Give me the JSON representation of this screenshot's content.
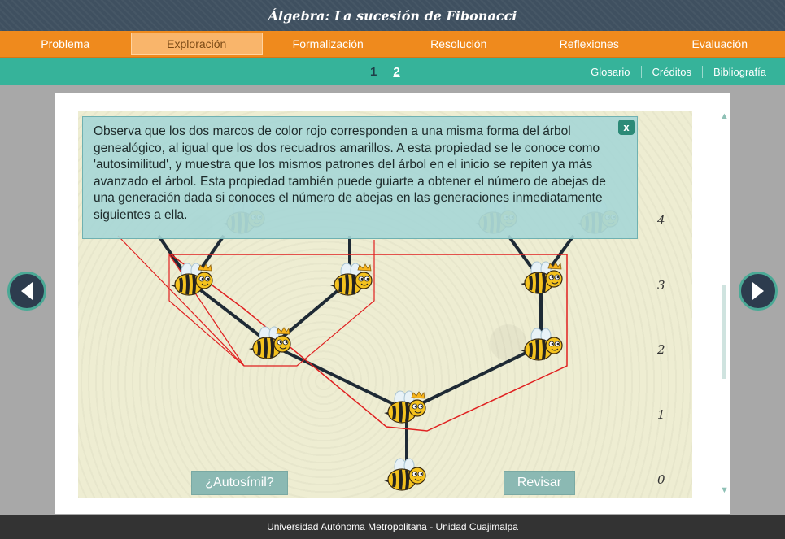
{
  "app": {
    "title": "Álgebra: La sucesión de Fibonacci"
  },
  "main_nav": {
    "tabs": [
      {
        "label": "Problema"
      },
      {
        "label": "Exploración",
        "active": true
      },
      {
        "label": "Formalización"
      },
      {
        "label": "Resolución"
      },
      {
        "label": "Reflexiones"
      },
      {
        "label": "Evaluación"
      }
    ]
  },
  "sub_nav": {
    "pages": [
      "1",
      "2"
    ],
    "current_page": "2",
    "links": [
      "Glosario",
      "Créditos",
      "Bibliografía"
    ]
  },
  "overlay": {
    "text": "Observa que los dos marcos de color rojo corresponden a una misma forma del árbol genealógico, al igual que los dos recuadros amarillos. A esta propiedad se le conoce como 'autosimilitud', y muestra que los mismos patrones del árbol en el inicio se repiten ya más avanzado el árbol. Esta propiedad también puede guiarte a obtener el número de abejas de una generación dada si conoces el número de abejas en las generaciones inmediatamente siguientes a ella.",
    "close_label": "x"
  },
  "generations": [
    "4",
    "3",
    "2",
    "1",
    "0"
  ],
  "buttons": {
    "autosimil": "¿Autosímil?",
    "revisar": "Revisar"
  },
  "footer": {
    "text": "Universidad Autónoma Metropolitana - Unidad Cuajimalpa"
  },
  "colors": {
    "orange": "#ef8a1d",
    "teal": "#36b39a",
    "dark": "#3f5060",
    "frame_red": "#e02020"
  },
  "icons": {
    "prev": "chevron-left-icon",
    "next": "chevron-right-icon",
    "bee": "bee-icon",
    "queen": "queen-bee-icon"
  }
}
